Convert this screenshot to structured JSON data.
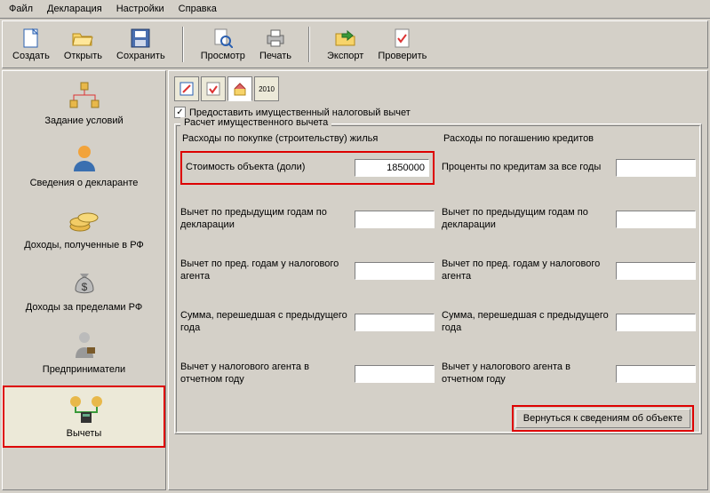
{
  "menu": [
    "Файл",
    "Декларация",
    "Настройки",
    "Справка"
  ],
  "toolbar": {
    "create": "Создать",
    "open": "Открыть",
    "save": "Сохранить",
    "preview": "Просмотр",
    "print": "Печать",
    "export": "Экспорт",
    "check": "Проверить"
  },
  "sidebar": [
    {
      "label": "Задание условий"
    },
    {
      "label": "Сведения о декларанте"
    },
    {
      "label": "Доходы, полученные в РФ"
    },
    {
      "label": "Доходы за пределами РФ"
    },
    {
      "label": "Предприниматели"
    },
    {
      "label": "Вычеты"
    }
  ],
  "tabs": {
    "year": "2010"
  },
  "checkbox": {
    "label": "Предоставить имущественный налоговый вычет",
    "checked": true
  },
  "group_title": "Расчет имущественного вычета",
  "left": {
    "title": "Расходы по покупке (строительству) жилья",
    "f1": {
      "label": "Стоимость объекта (доли)",
      "value": "1850000"
    },
    "f2": {
      "label": "Вычет по предыдущим годам по декларации",
      "value": ""
    },
    "f3": {
      "label": "Вычет по пред. годам у налогового агента",
      "value": ""
    },
    "f4": {
      "label": "Сумма, перешедшая с предыдущего года",
      "value": ""
    },
    "f5": {
      "label": "Вычет у налогового агента в отчетном году",
      "value": ""
    }
  },
  "right": {
    "title": "Расходы по погашению кредитов",
    "f1": {
      "label": "Проценты по кредитам за все годы",
      "value": ""
    },
    "f2": {
      "label": "Вычет по предыдущим годам по декларации",
      "value": ""
    },
    "f3": {
      "label": "Вычет по пред. годам у налогового агента",
      "value": ""
    },
    "f4": {
      "label": "Сумма, перешедшая с предыдущего года",
      "value": ""
    },
    "f5": {
      "label": "Вычет у налогового агента в отчетном году",
      "value": ""
    }
  },
  "back_button": "Вернуться к сведениям об объекте"
}
